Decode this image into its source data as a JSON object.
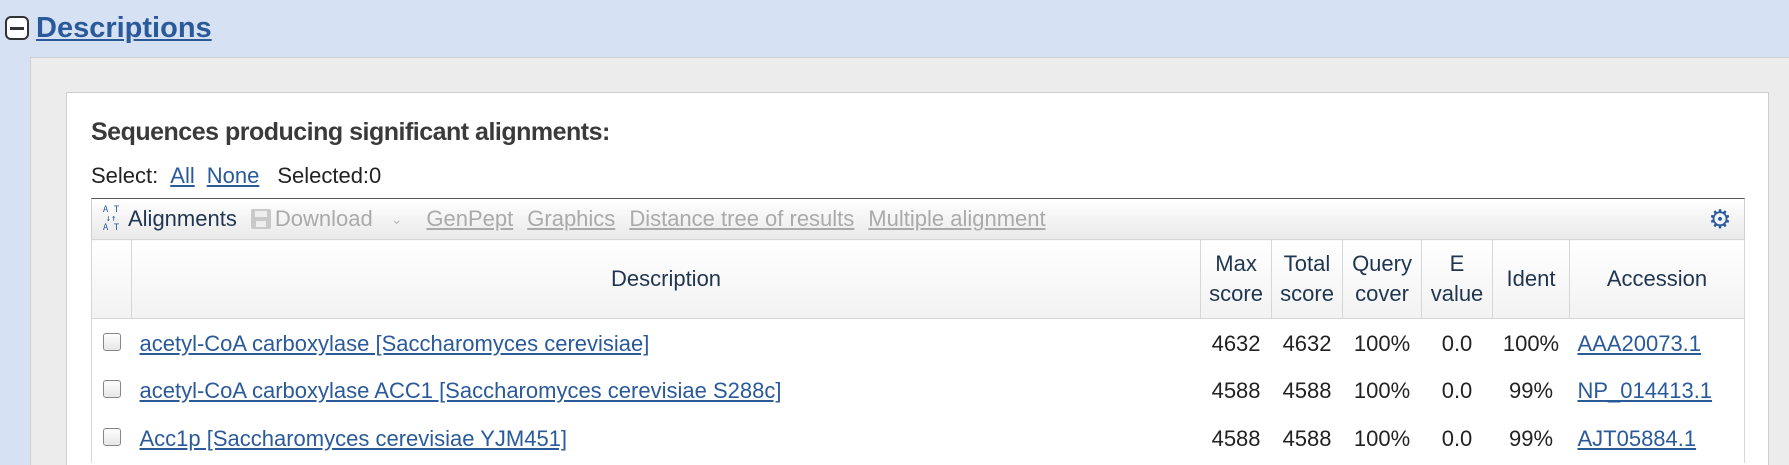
{
  "section": {
    "title": "Descriptions"
  },
  "heading": "Sequences producing significant alignments:",
  "select": {
    "label": "Select:",
    "all": "All",
    "none": "None",
    "selected": "Selected:0"
  },
  "toolbar": {
    "alignments": "Alignments",
    "download": "Download",
    "genpept": "GenPept",
    "graphics": "Graphics",
    "distance_tree": "Distance tree of results",
    "multiple_alignment": "Multiple alignment",
    "align_icon_glyph": "A T\nA T"
  },
  "table": {
    "headers": {
      "description": "Description",
      "max_score": [
        "Max",
        "score"
      ],
      "total_score": [
        "Total",
        "score"
      ],
      "query_cover": [
        "Query",
        "cover"
      ],
      "e_value": [
        "E",
        "value"
      ],
      "ident": "Ident",
      "accession": "Accession"
    },
    "rows": [
      {
        "description": "acetyl-CoA carboxylase [Saccharomyces cerevisiae]",
        "max_score": "4632",
        "total_score": "4632",
        "query_cover": "100%",
        "e_value": "0.0",
        "ident": "100%",
        "accession": "AAA20073.1"
      },
      {
        "description": "acetyl-CoA carboxylase ACC1 [Saccharomyces cerevisiae S288c]",
        "max_score": "4588",
        "total_score": "4588",
        "query_cover": "100%",
        "e_value": "0.0",
        "ident": "99%",
        "accession": "NP_014413.1"
      },
      {
        "description": "Acc1p [Saccharomyces cerevisiae YJM451]",
        "max_score": "4588",
        "total_score": "4588",
        "query_cover": "100%",
        "e_value": "0.0",
        "ident": "99%",
        "accession": "AJT05884.1"
      }
    ]
  },
  "colors": {
    "header_bg": "#d6e1f4",
    "link": "#2a5a9a",
    "panel_bg": "#ececec"
  },
  "icons": {
    "collapse": "minus-box-icon",
    "alignments": "alignment-icon",
    "download": "floppy-disk-icon",
    "settings": "gear-icon"
  }
}
